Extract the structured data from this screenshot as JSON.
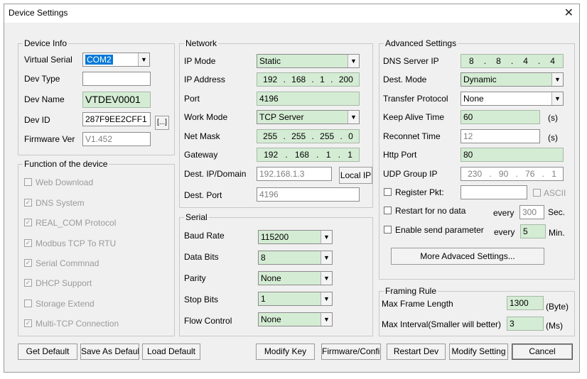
{
  "window": {
    "title": "Device Settings",
    "close_glyph": "✕"
  },
  "device_info": {
    "legend": "Device Info",
    "virtual_serial_label": "Virtual Serial",
    "virtual_serial_value": "COM2",
    "dev_type_label": "Dev Type",
    "dev_type_value": "",
    "dev_name_label": "Dev Name",
    "dev_name_value": "VTDEV0001",
    "dev_id_label": "Dev ID",
    "dev_id_value": "287F9EE2CFF1",
    "dev_id_button": "[...]",
    "firmware_label": "Firmware Ver",
    "firmware_value": "V1.452"
  },
  "function": {
    "legend": "Function of the device",
    "items": [
      {
        "label": "Web Download",
        "checked": false
      },
      {
        "label": "DNS System",
        "checked": true
      },
      {
        "label": "REAL_COM Protocol",
        "checked": true
      },
      {
        "label": "Modbus TCP To RTU",
        "checked": true
      },
      {
        "label": "Serial Commnad",
        "checked": true
      },
      {
        "label": "DHCP Support",
        "checked": true
      },
      {
        "label": "Storage Extend",
        "checked": false
      },
      {
        "label": "Multi-TCP Connection",
        "checked": true
      }
    ]
  },
  "network": {
    "legend": "Network",
    "ip_mode_label": "IP Mode",
    "ip_mode_value": "Static",
    "ip_address_label": "IP Address",
    "ip_address": [
      "192",
      "168",
      "1",
      "200"
    ],
    "port_label": "Port",
    "port_value": "4196",
    "work_mode_label": "Work Mode",
    "work_mode_value": "TCP Server",
    "net_mask_label": "Net Mask",
    "net_mask": [
      "255",
      "255",
      "255",
      "0"
    ],
    "gateway_label": "Gateway",
    "gateway": [
      "192",
      "168",
      "1",
      "1"
    ],
    "dest_ip_label": "Dest. IP/Domain",
    "dest_ip_value": "192.168.1.3",
    "local_ip_button": "Local IP",
    "dest_port_label": "Dest. Port",
    "dest_port_value": "4196"
  },
  "serial": {
    "legend": "Serial",
    "baud_label": "Baud Rate",
    "baud_value": "115200",
    "data_bits_label": "Data Bits",
    "data_bits_value": "8",
    "parity_label": "Parity",
    "parity_value": "None",
    "stop_bits_label": "Stop Bits",
    "stop_bits_value": "1",
    "flow_label": "Flow Control",
    "flow_value": "None"
  },
  "advanced": {
    "legend": "Advanced Settings",
    "dns_label": "DNS Server IP",
    "dns": [
      "8",
      "8",
      "4",
      "4"
    ],
    "dest_mode_label": "Dest. Mode",
    "dest_mode_value": "Dynamic",
    "transfer_label": "Transfer Protocol",
    "transfer_value": "None",
    "keep_alive_label": "Keep Alive Time",
    "keep_alive_value": "60",
    "keep_alive_unit": "(s)",
    "reconnect_label": "Reconnet Time",
    "reconnect_value": "12",
    "reconnect_unit": "(s)",
    "http_label": "Http Port",
    "http_value": "80",
    "udp_label": "UDP Group IP",
    "udp": [
      "230",
      "90",
      "76",
      "1"
    ],
    "register_label": "Register Pkt:",
    "ascii_label": "ASCII",
    "restart_label": "Restart for no data",
    "restart_every": "every",
    "restart_value": "300",
    "restart_unit": "Sec.",
    "enable_label": "Enable send parameter",
    "enable_every": "every",
    "enable_value": "5",
    "enable_unit": "Min.",
    "more_button": "More Advaced Settings..."
  },
  "framing": {
    "legend": "Framing Rule",
    "max_frame_label": "Max Frame Length",
    "max_frame_value": "1300",
    "max_frame_unit": "(Byte)",
    "max_interval_label": "Max Interval(Smaller will better)",
    "max_interval_value": "3",
    "max_interval_unit": "(Ms)"
  },
  "buttons": {
    "get_default": "Get Default",
    "save_as_default": "Save As Default",
    "load_default": "Load Default",
    "modify_key": "Modify Key",
    "firmware_config": "Firmware/Config",
    "restart_dev": "Restart Dev",
    "modify_setting": "Modify Setting",
    "cancel": "Cancel"
  },
  "icons": {
    "dropdown": "chevron-down-icon",
    "close": "close-icon",
    "check": "checkmark-icon"
  },
  "colors": {
    "field_green": "#d4ecd4",
    "selection_blue": "#0078d7",
    "dialog_bg": "#f0f0f0"
  }
}
